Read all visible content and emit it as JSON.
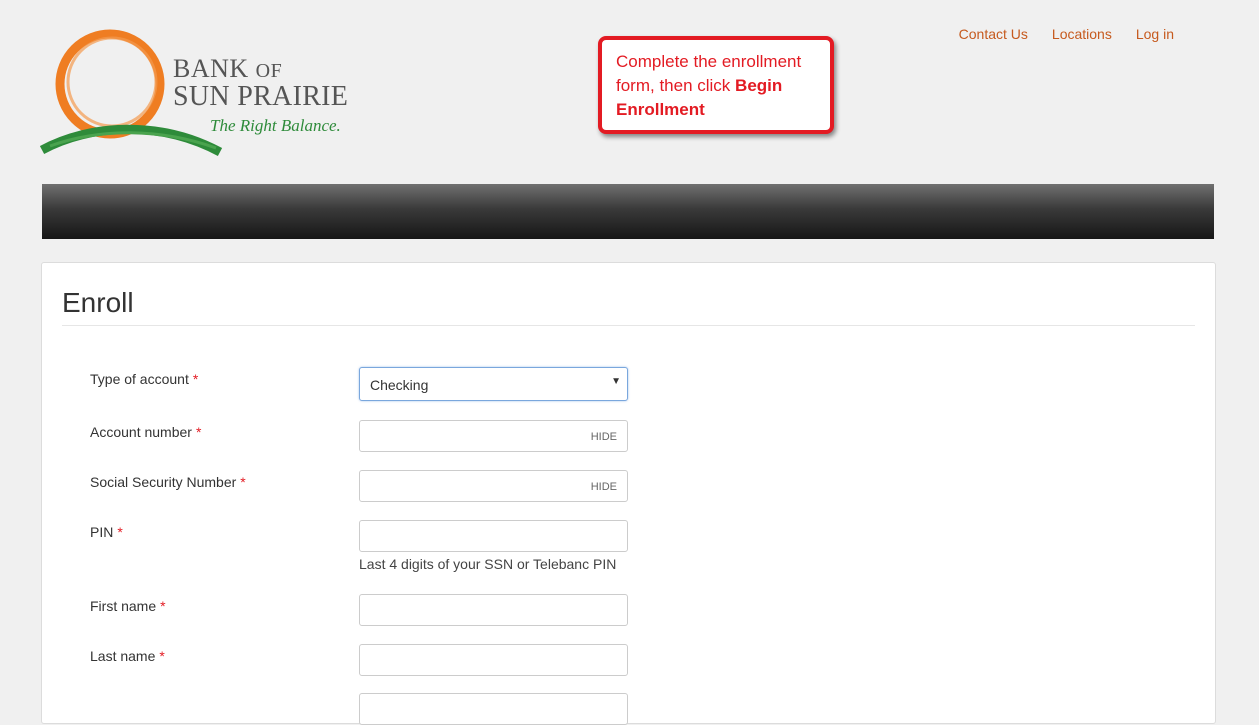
{
  "brand": {
    "line1": "BANK",
    "line1_of": "OF",
    "line2": "SUN PRAIRIE",
    "tagline": "The Right Balance."
  },
  "topnav": {
    "contact": "Contact Us",
    "locations": "Locations",
    "login": "Log in"
  },
  "callout": {
    "text": "Complete the enrollment form, then click",
    "bold": "Begin Enrollment"
  },
  "form": {
    "title": "Enroll",
    "required_mark": "*",
    "fields": {
      "account_type": {
        "label": "Type of account",
        "value": "Checking"
      },
      "account_number": {
        "label": "Account number",
        "toggle": "HIDE"
      },
      "ssn": {
        "label": "Social Security Number",
        "toggle": "HIDE"
      },
      "pin": {
        "label": "PIN",
        "help": "Last 4 digits of your SSN or Telebanc PIN"
      },
      "first_name": {
        "label": "First name"
      },
      "last_name": {
        "label": "Last name"
      }
    }
  },
  "colors": {
    "link": "#c65a1e",
    "callout": "#e31b23",
    "logo_orange": "#ef7d22",
    "logo_green": "#2e8b3a"
  }
}
